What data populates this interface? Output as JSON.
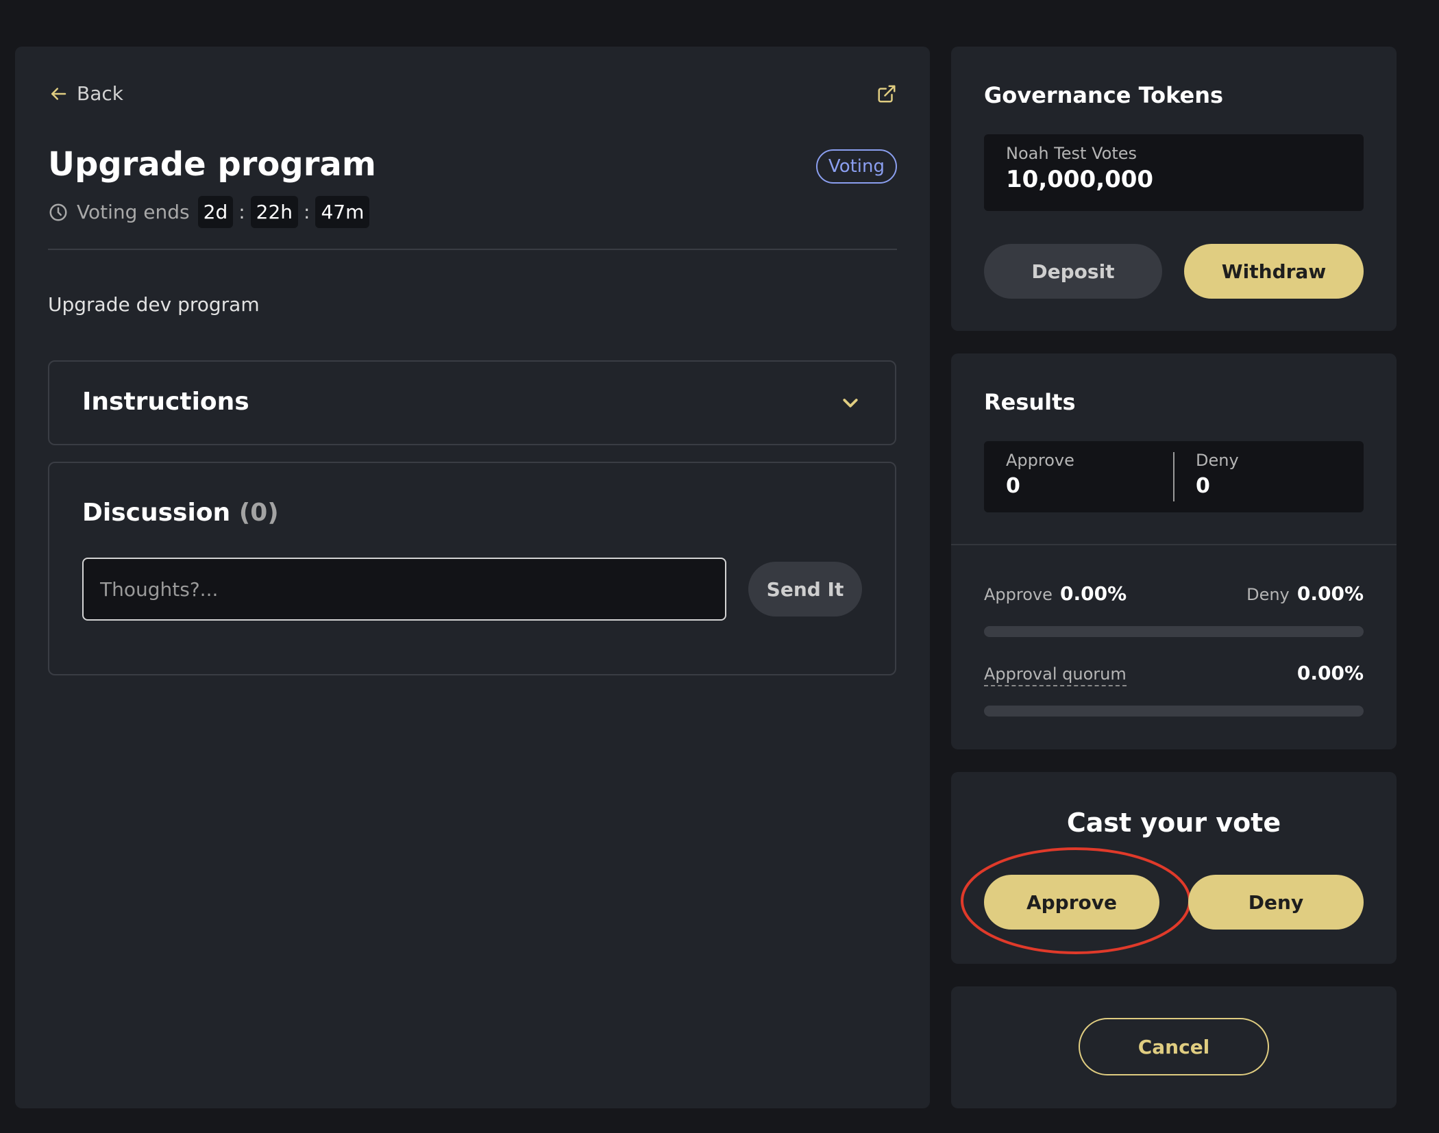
{
  "proposal": {
    "back_label": "Back",
    "title": "Upgrade program",
    "status": "Voting",
    "voting_ends_label": "Voting ends",
    "countdown": {
      "days": "2d",
      "hours": "22h",
      "minutes": "47m",
      "separator": ":"
    },
    "description": "Upgrade dev program"
  },
  "instructions": {
    "title": "Instructions"
  },
  "discussion": {
    "title": "Discussion",
    "count": "(0)",
    "input_placeholder": "Thoughts?...",
    "send_label": "Send It"
  },
  "governance": {
    "title": "Governance Tokens",
    "votes_label": "Noah Test Votes",
    "votes_value": "10,000,000",
    "deposit_label": "Deposit",
    "withdraw_label": "Withdraw"
  },
  "results": {
    "title": "Results",
    "approve_label": "Approve",
    "approve_count": "0",
    "deny_label": "Deny",
    "deny_count": "0",
    "approve_pct_label": "Approve",
    "approve_pct": "0.00%",
    "deny_pct_label": "Deny",
    "deny_pct": "0.00%",
    "vote_bar_fraction": 0.0,
    "quorum_label": "Approval quorum",
    "quorum_pct": "0.00%",
    "quorum_bar_fraction": 0.0
  },
  "cast_vote": {
    "title": "Cast your vote",
    "approve_label": "Approve",
    "deny_label": "Deny"
  },
  "cancel": {
    "label": "Cancel"
  },
  "colors": {
    "accent": "#e0cd81",
    "badge": "#8b9ff0",
    "annotation": "#e03a2a",
    "panel": "#21242a",
    "background": "#16171b"
  },
  "icons": {
    "back": "arrow-left-icon",
    "external": "external-link-icon",
    "clock": "clock-icon",
    "chevron": "chevron-down-icon"
  }
}
